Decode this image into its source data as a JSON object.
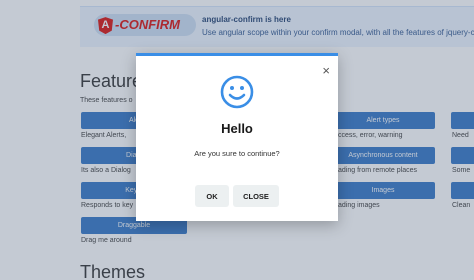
{
  "banner": {
    "logo_text": "-CONFIRM",
    "logo_mark": "A",
    "title": "angular-confirm is here",
    "description": "Use angular scope within your confirm modal, with all the features of jquery-co"
  },
  "features": {
    "title": "Feature",
    "intro": "These features o",
    "chips": [
      {
        "label": "Ale",
        "desc": "Elegant Alerts,"
      },
      {
        "label": "Alert types",
        "desc": "ccess, error, warning"
      },
      {
        "label": "",
        "desc": "Need"
      },
      {
        "label": "Dialo",
        "desc": "Its also a Dialog"
      },
      {
        "label": "Asynchronous content",
        "desc": "ading from remote places"
      },
      {
        "label": "",
        "desc": "Some"
      },
      {
        "label": "Keyst",
        "desc": "Responds to key"
      },
      {
        "label": "Images",
        "desc": "ading images"
      },
      {
        "label": "",
        "desc": "Clean"
      },
      {
        "label": "Draggable",
        "desc": "Drag me around"
      }
    ]
  },
  "themes": {
    "title": "Themes"
  },
  "modal": {
    "icon": "smile-icon",
    "title": "Hello",
    "content": "Are you sure to continue?",
    "close_glyph": "×",
    "ok_label": "OK",
    "close_label": "CLOSE"
  },
  "colors": {
    "accent": "#3a8ee6",
    "chip": "#3b7cc9",
    "logo_red": "#dd1b16"
  }
}
